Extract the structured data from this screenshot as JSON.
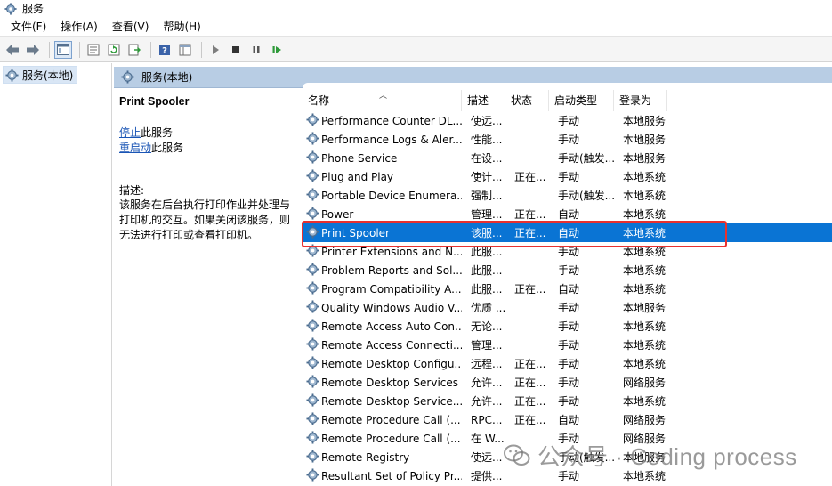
{
  "window": {
    "title": "服务"
  },
  "menu": [
    "文件(F)",
    "操作(A)",
    "查看(V)",
    "帮助(H)"
  ],
  "tree": {
    "root_label": "服务(本地)"
  },
  "pane": {
    "header": "服务(本地)"
  },
  "detail": {
    "service_name": "Print Spooler",
    "stop_link": "停止",
    "stop_suffix": "此服务",
    "restart_link": "重启动",
    "restart_suffix": "此服务",
    "description_label": "描述:",
    "description": "该服务在后台执行打印作业并处理与打印机的交互。如果关闭该服务，则无法进行打印或查看打印机。"
  },
  "columns": [
    "名称",
    "描述",
    "状态",
    "启动类型",
    "登录为"
  ],
  "services": [
    {
      "name": "Performance Counter DL...",
      "desc": "使远...",
      "status": "",
      "startup": "手动",
      "logon": "本地服务"
    },
    {
      "name": "Performance Logs & Aler...",
      "desc": "性能...",
      "status": "",
      "startup": "手动",
      "logon": "本地服务"
    },
    {
      "name": "Phone Service",
      "desc": "在设...",
      "status": "",
      "startup": "手动(触发...",
      "logon": "本地服务"
    },
    {
      "name": "Plug and Play",
      "desc": "使计...",
      "status": "正在...",
      "startup": "手动",
      "logon": "本地系统"
    },
    {
      "name": "Portable Device Enumera...",
      "desc": "强制...",
      "status": "",
      "startup": "手动(触发...",
      "logon": "本地系统"
    },
    {
      "name": "Power",
      "desc": "管理...",
      "status": "正在...",
      "startup": "自动",
      "logon": "本地系统"
    },
    {
      "name": "Print Spooler",
      "desc": "该服...",
      "status": "正在...",
      "startup": "自动",
      "logon": "本地系统",
      "selected": true
    },
    {
      "name": "Printer Extensions and N...",
      "desc": "此服...",
      "status": "",
      "startup": "手动",
      "logon": "本地系统"
    },
    {
      "name": "Problem Reports and Sol...",
      "desc": "此服...",
      "status": "",
      "startup": "手动",
      "logon": "本地系统"
    },
    {
      "name": "Program Compatibility A...",
      "desc": "此服...",
      "status": "正在...",
      "startup": "自动",
      "logon": "本地系统"
    },
    {
      "name": "Quality Windows Audio V...",
      "desc": "优质 ...",
      "status": "",
      "startup": "手动",
      "logon": "本地服务"
    },
    {
      "name": "Remote Access Auto Con...",
      "desc": "无论...",
      "status": "",
      "startup": "手动",
      "logon": "本地系统"
    },
    {
      "name": "Remote Access Connecti...",
      "desc": "管理...",
      "status": "",
      "startup": "手动",
      "logon": "本地系统"
    },
    {
      "name": "Remote Desktop Configu...",
      "desc": "远程...",
      "status": "正在...",
      "startup": "手动",
      "logon": "本地系统"
    },
    {
      "name": "Remote Desktop Services",
      "desc": "允许...",
      "status": "正在...",
      "startup": "手动",
      "logon": "网络服务"
    },
    {
      "name": "Remote Desktop Service...",
      "desc": "允许...",
      "status": "正在...",
      "startup": "手动",
      "logon": "本地系统"
    },
    {
      "name": "Remote Procedure Call (...",
      "desc": "RPC...",
      "status": "正在...",
      "startup": "自动",
      "logon": "网络服务"
    },
    {
      "name": "Remote Procedure Call (...",
      "desc": "在 W...",
      "status": "",
      "startup": "手动",
      "logon": "网络服务"
    },
    {
      "name": "Remote Registry",
      "desc": "使远...",
      "status": "",
      "startup": "手动(触发...",
      "logon": "本地服务"
    },
    {
      "name": "Resultant Set of Policy Pr...",
      "desc": "提供...",
      "status": "",
      "startup": "手动",
      "logon": "本地系统"
    }
  ],
  "watermark": {
    "text": "公众号 · Coding process"
  },
  "colors": {
    "selection": "#0a74d4",
    "highlight_border": "#e8312f",
    "pane_header": "#b8cde4"
  },
  "icons": {
    "service": "gear-icon",
    "app": "services-app-icon"
  }
}
